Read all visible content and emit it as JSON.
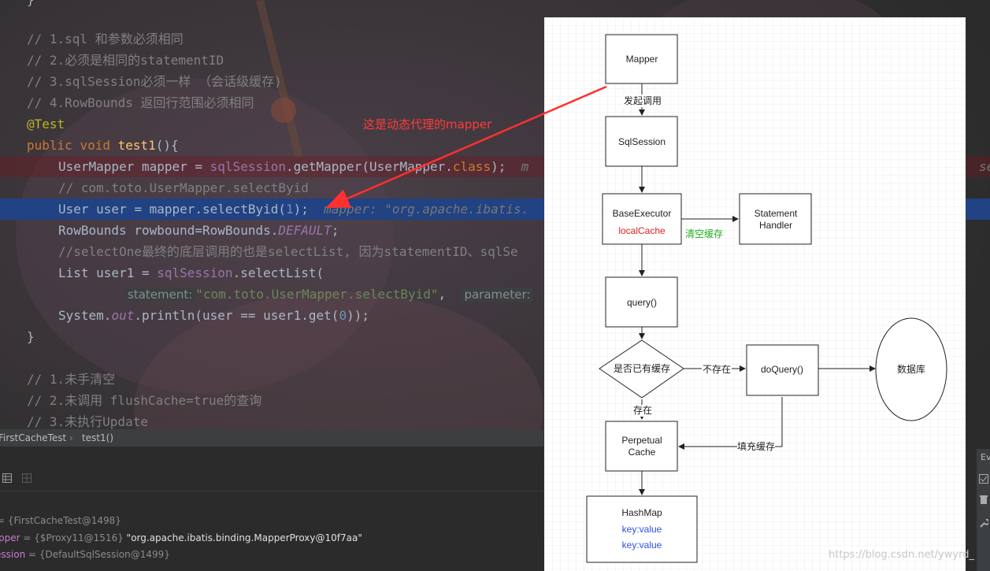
{
  "editor": {
    "top_brace": "}",
    "comments_top": [
      "// 1.sql 和参数必须相同",
      "// 2.必须是相同的statementID",
      "// 3.sqlSession必须一样 （会话级缓存)",
      "// 4.RowBounds 返回行范围必须相同"
    ],
    "annotation": "@Test",
    "method_kw1": "public",
    "method_kw2": "void",
    "method_name": "test1",
    "method_tail": "(){",
    "l_mapper_a": "UserMapper mapper = ",
    "l_mapper_b": "sqlSession",
    "l_mapper_c": ".getMapper(UserMapper.",
    "l_mapper_d": "class",
    "l_mapper_e": ");",
    "l_mapper_hint": "m",
    "l_mapper_hint_right": "se",
    "l_comment_select": "// com.toto.UserMapper.selectByid",
    "l_user_a": "User user = mapper.selectByid(",
    "l_user_num": "1",
    "l_user_b": ");",
    "l_user_hint": "mapper: \"org.apache.ibatis.",
    "l_rb_a": "RowBounds rowbound=RowBounds.",
    "l_rb_b": "DEFAULT",
    "l_rb_c": ";",
    "l_comment_selectone": "//selectOne最终的底层调用的也是selectList, 因为statementID、sqlSe",
    "l_list_a": "List user1 = ",
    "l_list_b": "sqlSession",
    "l_list_c": ".selectList(",
    "l_stmt_label": "statement:",
    "l_stmt_str": "\"com.toto.UserMapper.selectByid\"",
    "l_stmt_comma": ",",
    "l_param_label": "parameter:",
    "l_print_a": "System.",
    "l_print_b": "out",
    "l_print_c": ".println(user == user1.get(",
    "l_print_num": "0",
    "l_print_d": "));",
    "close_brace": "}",
    "comments_bottom": [
      "// 1.未手清空",
      "// 2.未调用 flushCache=true的查询",
      "// 3.未执行Update"
    ]
  },
  "breadcrumb": {
    "class_name": "FirstCacheTest",
    "separator": "›",
    "method": "test1()"
  },
  "debug": {
    "vars": [
      {
        "name": "",
        "value": "= {FirstCacheTest@1498}",
        "str": ""
      },
      {
        "name": "pper",
        "value": "= {$Proxy11@1516}",
        "str": "\"org.apache.ibatis.binding.MapperProxy@10f7aa\""
      },
      {
        "name": "ession",
        "value": "= {DefaultSqlSession@1499}",
        "str": ""
      }
    ],
    "side_label": "Ev"
  },
  "annotation_red": "这是动态代理的mapper",
  "diagram": {
    "nodes": {
      "mapper": "Mapper",
      "sqlsession": "SqlSession",
      "baseexecutor": "BaseExecutor",
      "localcache": "localCache",
      "statement_handler_1": "Statement",
      "statement_handler_2": "Handler",
      "query": "query()",
      "decision": "是否已有缓存",
      "doquery": "doQuery()",
      "database": "数据库",
      "perpetual_1": "Perpetual",
      "perpetual_2": "Cache",
      "hashmap": "HashMap",
      "kv1": "key:value",
      "kv2": "key:value"
    },
    "edges": {
      "invoke": "发起调用",
      "clear_cache": "清空缓存",
      "not_exist": "不存在",
      "exist": "存在",
      "fill_cache": "填充缓存"
    },
    "colors": {
      "localcache": "#e02020",
      "clear_cache": "#20b020",
      "kv": "#3050e0",
      "arrow": "#ff3030"
    }
  },
  "watermark": "https://blog.csdn.net/ywyrd_"
}
